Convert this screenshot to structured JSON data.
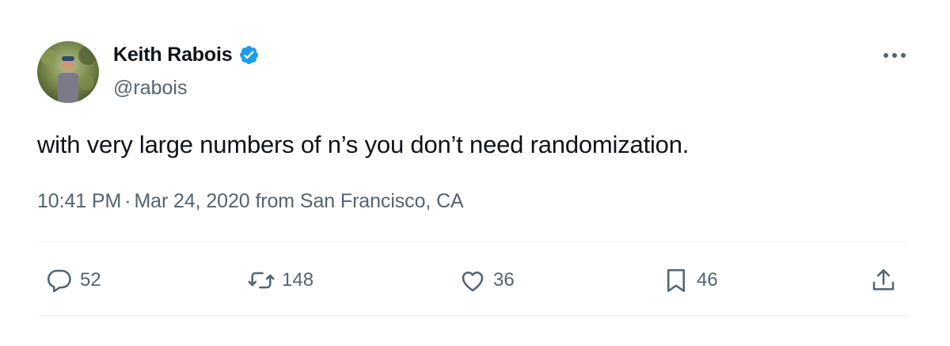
{
  "author": {
    "name": "Keith Rabois",
    "handle": "@rabois",
    "verified": true,
    "verified_color": "#1d9bf0"
  },
  "tweet": {
    "text": "with very large numbers of n’s you don’t need randomization.",
    "time": "10:41 PM",
    "separator": "·",
    "date": "Mar 24, 2020",
    "location_text": "from San Francisco, CA"
  },
  "actions": {
    "replies": "52",
    "retweets": "148",
    "likes": "36",
    "bookmarks": "46"
  },
  "icons": {
    "verified": "verified-badge-icon",
    "more": "more-dots-icon",
    "reply": "reply-icon",
    "retweet": "retweet-icon",
    "like": "heart-icon",
    "bookmark": "bookmark-icon",
    "share": "share-icon"
  },
  "colors": {
    "text_primary": "#0f1419",
    "text_secondary": "#536471",
    "divider": "#eff3f4"
  }
}
